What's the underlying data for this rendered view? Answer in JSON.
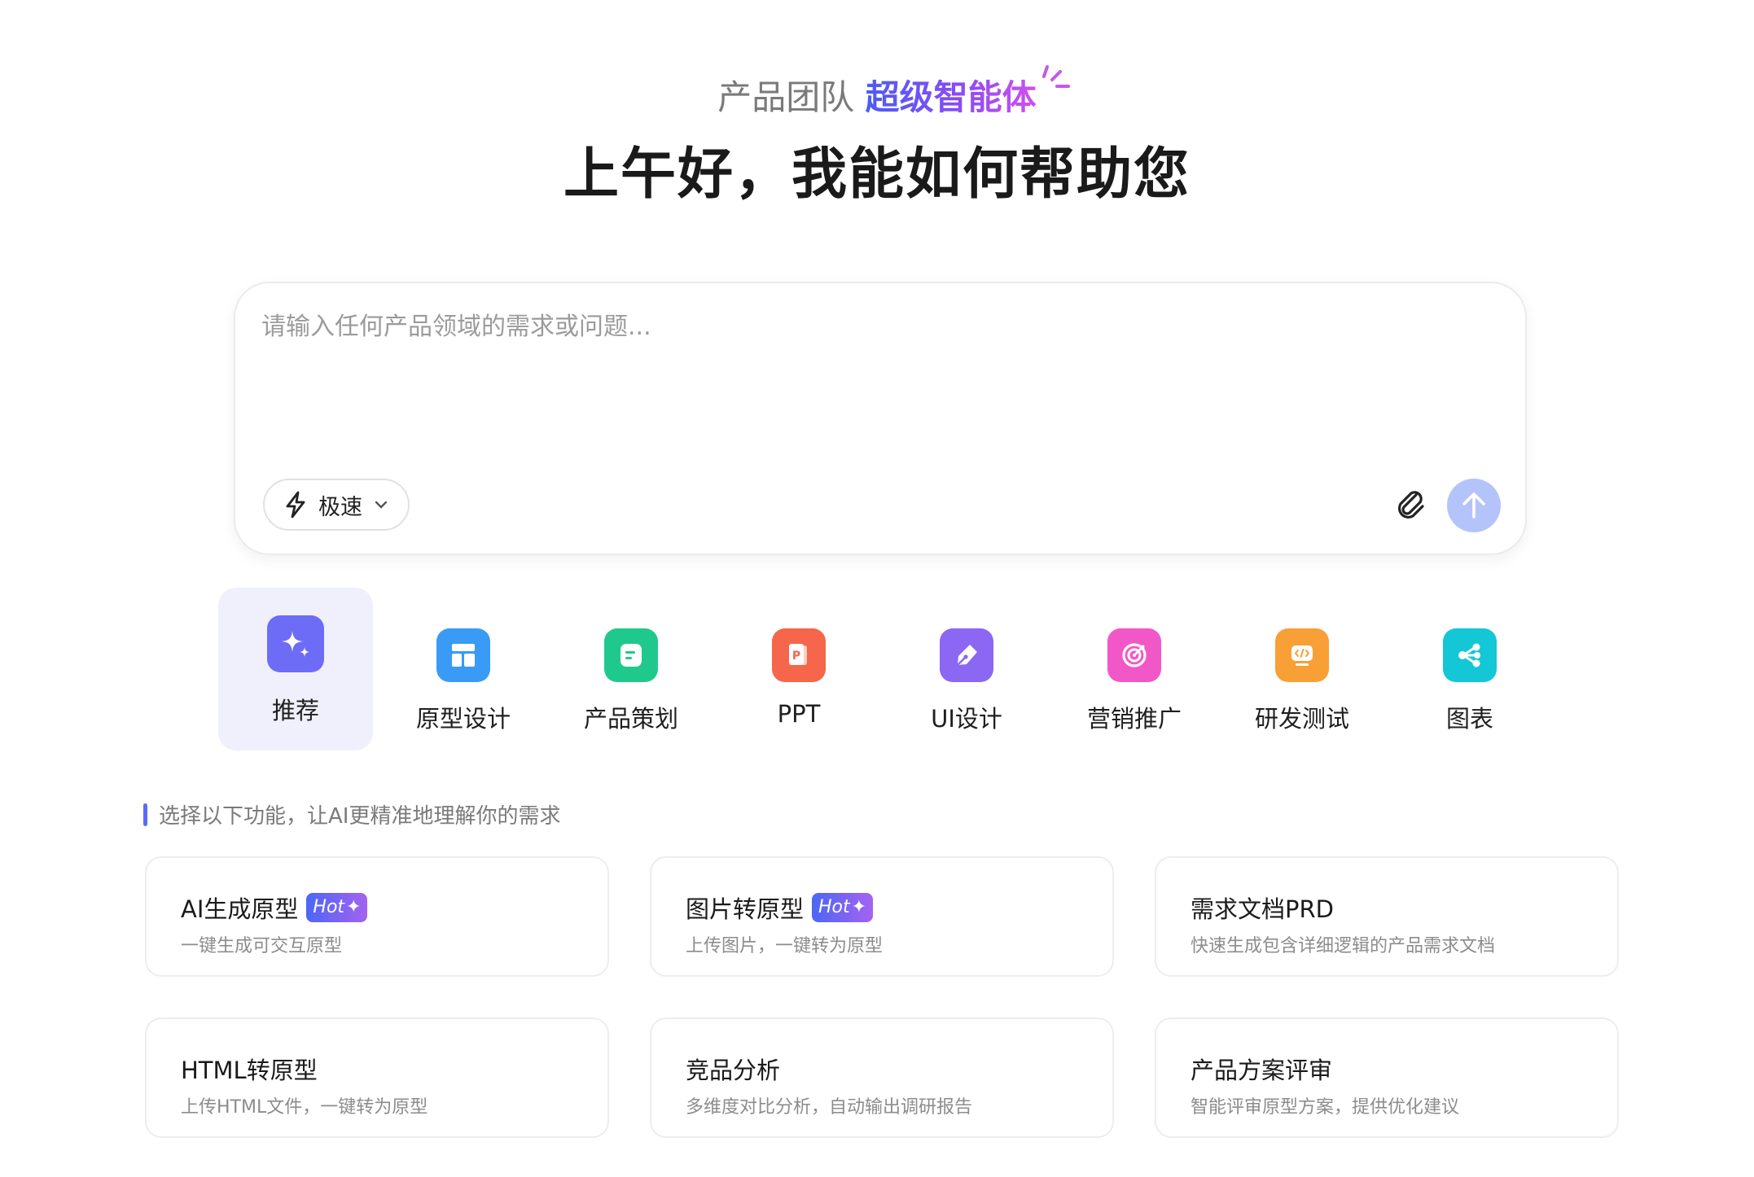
{
  "header": {
    "team_label": "产品团队",
    "agent_label": "超级智能体",
    "greeting": "上午好，我能如何帮助您"
  },
  "input": {
    "placeholder": "请输入任何产品领域的需求或问题...",
    "mode_label": "极速"
  },
  "tabs": [
    {
      "label": "推荐",
      "icon": "sparkle-icon",
      "color": "#6d6cf6",
      "active": true
    },
    {
      "label": "原型设计",
      "icon": "layout-icon",
      "color": "#3a9bf6"
    },
    {
      "label": "产品策划",
      "icon": "document-icon",
      "color": "#1fc98d"
    },
    {
      "label": "PPT",
      "icon": "ppt-icon",
      "color": "#f5664a"
    },
    {
      "label": "UI设计",
      "icon": "pen-icon",
      "color": "#8b67f4"
    },
    {
      "label": "营销推广",
      "icon": "target-icon",
      "color": "#f257c8"
    },
    {
      "label": "研发测试",
      "icon": "code-icon",
      "color": "#f8a035"
    },
    {
      "label": "图表",
      "icon": "share-nodes-icon",
      "color": "#13c7d6"
    }
  ],
  "hint": "选择以下功能，让AI更精准地理解你的需求",
  "hot_badge": "Hot",
  "cards": [
    {
      "title": "AI生成原型",
      "desc": "一键生成可交互原型",
      "hot": true
    },
    {
      "title": "图片转原型",
      "desc": "上传图片，一键转为原型",
      "hot": true
    },
    {
      "title": "需求文档PRD",
      "desc": "快速生成包含详细逻辑的产品需求文档",
      "hot": false
    },
    {
      "title": "HTML转原型",
      "desc": "上传HTML文件，一键转为原型",
      "hot": false
    },
    {
      "title": "竞品分析",
      "desc": "多维度对比分析，自动输出调研报告",
      "hot": false
    },
    {
      "title": "产品方案评审",
      "desc": "智能评审原型方案，提供优化建议",
      "hot": false
    }
  ]
}
